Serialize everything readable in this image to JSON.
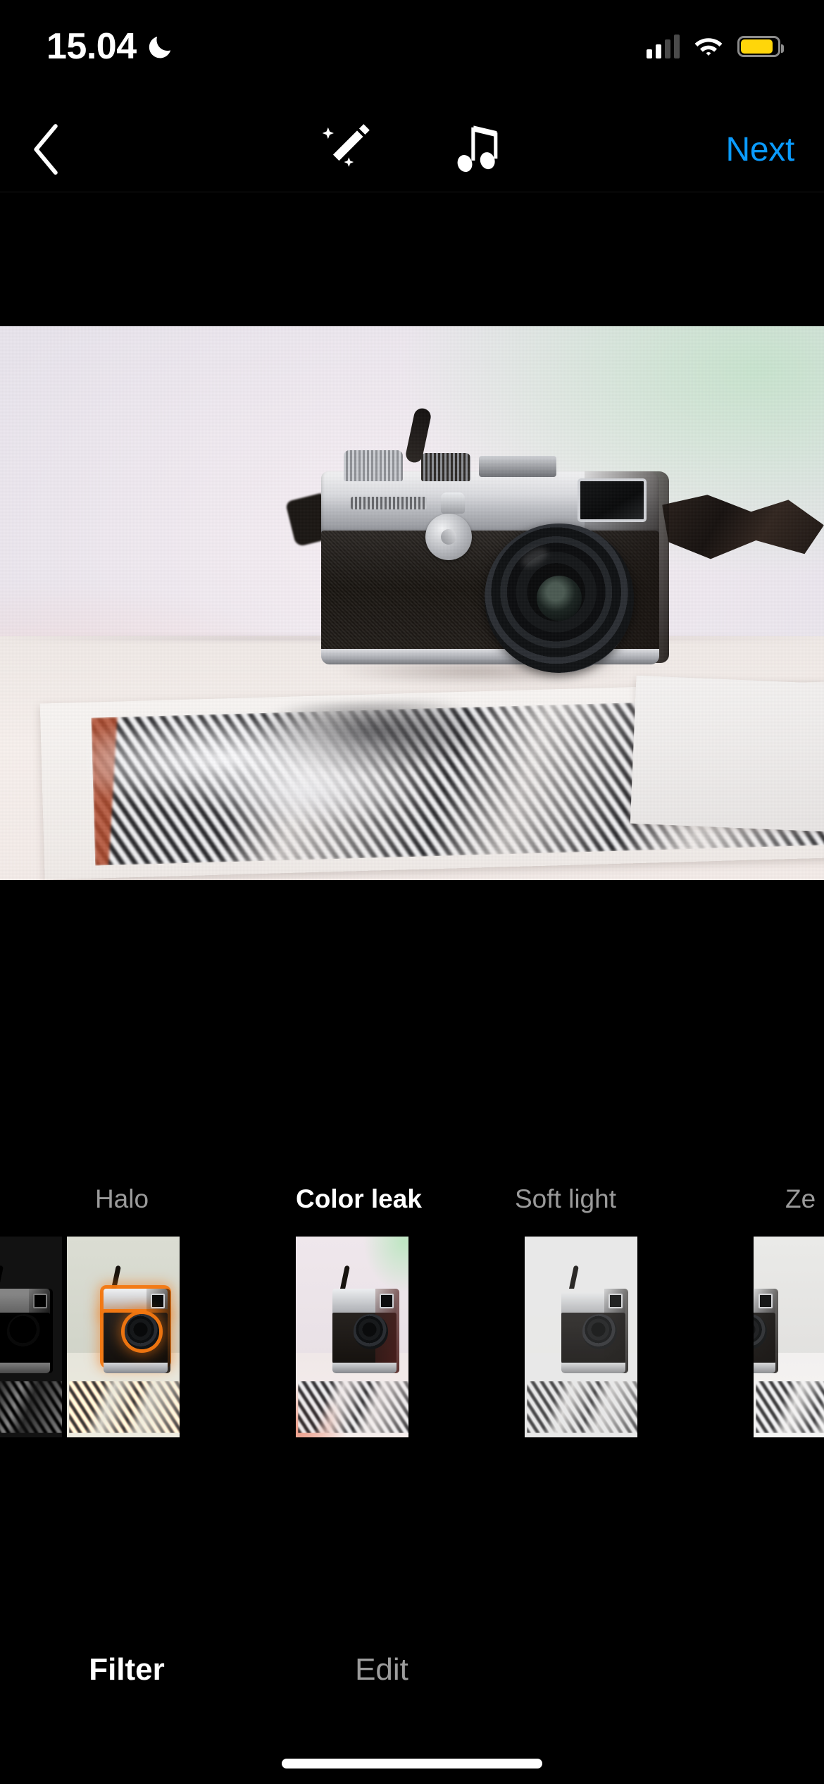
{
  "status_bar": {
    "time": "15.04",
    "dnd_icon": "moon-icon",
    "cellular_icon": "cellular-signal-icon",
    "wifi_icon": "wifi-icon",
    "battery_icon": "battery-icon",
    "battery_color": "#FFD60A",
    "battery_level_percent": 82
  },
  "nav_bar": {
    "back_icon": "chevron-left-icon",
    "magic_icon": "magic-wand-icon",
    "music_icon": "music-note-icon",
    "next_label": "Next",
    "next_color": "#0A9BFF"
  },
  "preview": {
    "alt": "Fujifilm rangefinder camera on a desk with black and white photo prints",
    "active_filter": "Color leak"
  },
  "filters": {
    "selected_index": 2,
    "items": [
      {
        "label": "",
        "effect": "bw",
        "visible_label": false,
        "partial": true
      },
      {
        "label": "Halo",
        "effect": "halo",
        "visible_label": true,
        "partial": false
      },
      {
        "label": "Color leak",
        "effect": "leak",
        "visible_label": true,
        "partial": false
      },
      {
        "label": "Soft light",
        "effect": "soft",
        "visible_label": true,
        "partial": false
      },
      {
        "label": "Ze",
        "effect": "zoom",
        "visible_label": true,
        "partial": true
      }
    ]
  },
  "bottom_tabs": {
    "active_index": 0,
    "items": [
      {
        "label": "Filter"
      },
      {
        "label": "Edit"
      }
    ]
  },
  "home_indicator": {
    "present": true
  }
}
